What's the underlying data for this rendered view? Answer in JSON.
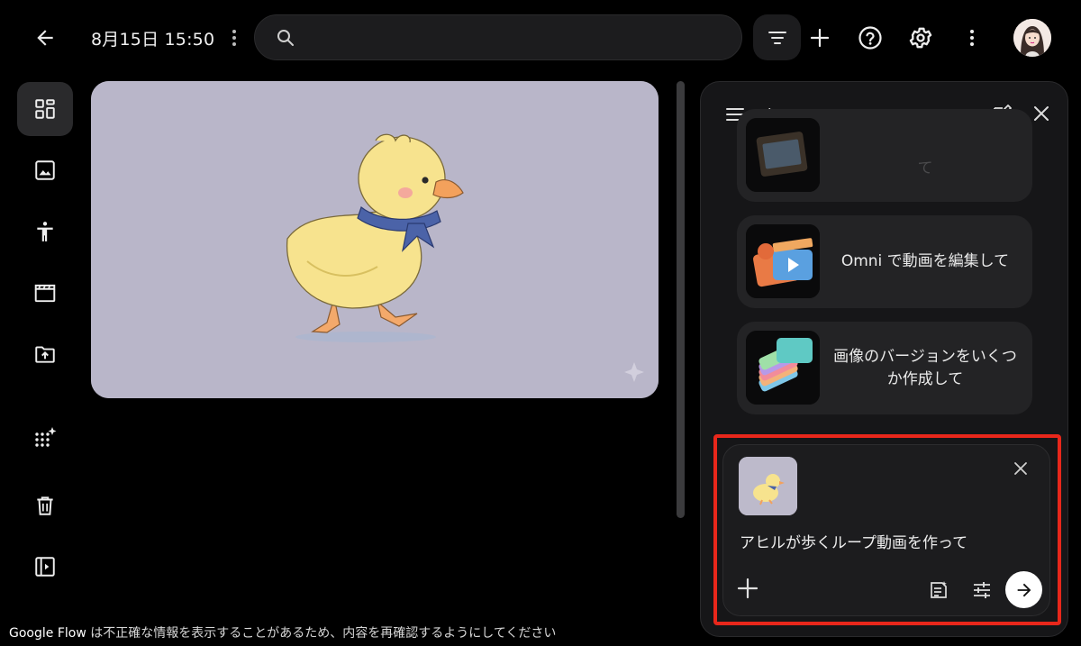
{
  "topbar": {
    "datetime": "8月15日 15:50",
    "search_placeholder": ""
  },
  "canvas": {
    "image_subject": "duckling illustration"
  },
  "panel": {
    "title": "無題のセッション",
    "suggestions": [
      {
        "label": "て",
        "faded": true
      },
      {
        "label": "Omni で動画を編集して"
      },
      {
        "label": "画像のバージョンをいくつか作成して"
      }
    ]
  },
  "composer": {
    "prompt": "アヒルが歩くループ動画を作って",
    "highlight_color": "#e8271b"
  },
  "disclaimer": {
    "brand": "Google Flow",
    "text": " は不正確な情報を表示することがあるため、内容を再確認するようにしてください"
  },
  "icons": {
    "back": "arrow-left-icon",
    "kebab": "more-vert-icon",
    "search": "search-icon",
    "filter": "filter-icon",
    "add": "plus-icon",
    "help": "help-icon",
    "settings": "gear-icon",
    "more": "more-vert-icon",
    "rail": [
      "grid-icon",
      "image-icon",
      "person-icon",
      "clapperboard-icon",
      "folder-upload-icon",
      "sparkle-grid-icon",
      "trash-icon",
      "sidebar-toggle-icon"
    ]
  }
}
